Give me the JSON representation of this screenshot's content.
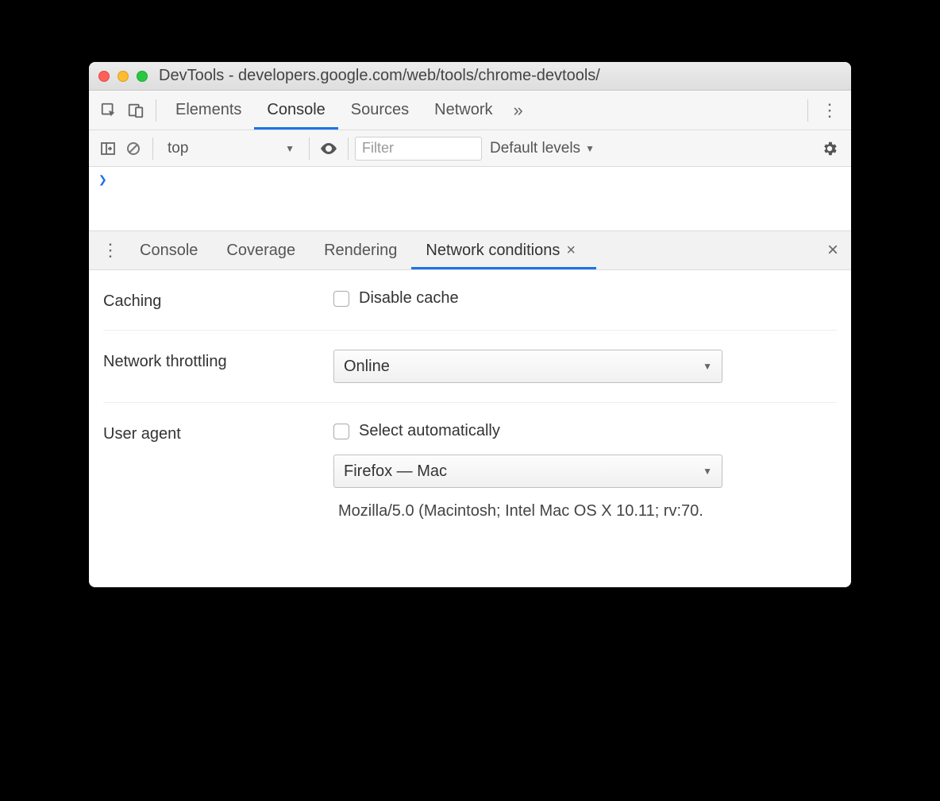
{
  "window": {
    "title": "DevTools - developers.google.com/web/tools/chrome-devtools/"
  },
  "tabs": {
    "elements": "Elements",
    "console": "Console",
    "sources": "Sources",
    "network": "Network"
  },
  "console_toolbar": {
    "context": "top",
    "filter_placeholder": "Filter",
    "levels": "Default levels"
  },
  "console": {
    "prompt": ">"
  },
  "drawer_tabs": {
    "console": "Console",
    "coverage": "Coverage",
    "rendering": "Rendering",
    "network_conditions": "Network conditions"
  },
  "network_conditions": {
    "caching_label": "Caching",
    "disable_cache_label": "Disable cache",
    "throttling_label": "Network throttling",
    "throttling_value": "Online",
    "user_agent_label": "User agent",
    "select_automatically_label": "Select automatically",
    "user_agent_value": "Firefox — Mac",
    "user_agent_string": "Mozilla/5.0 (Macintosh; Intel Mac OS X 10.11; rv:70."
  }
}
